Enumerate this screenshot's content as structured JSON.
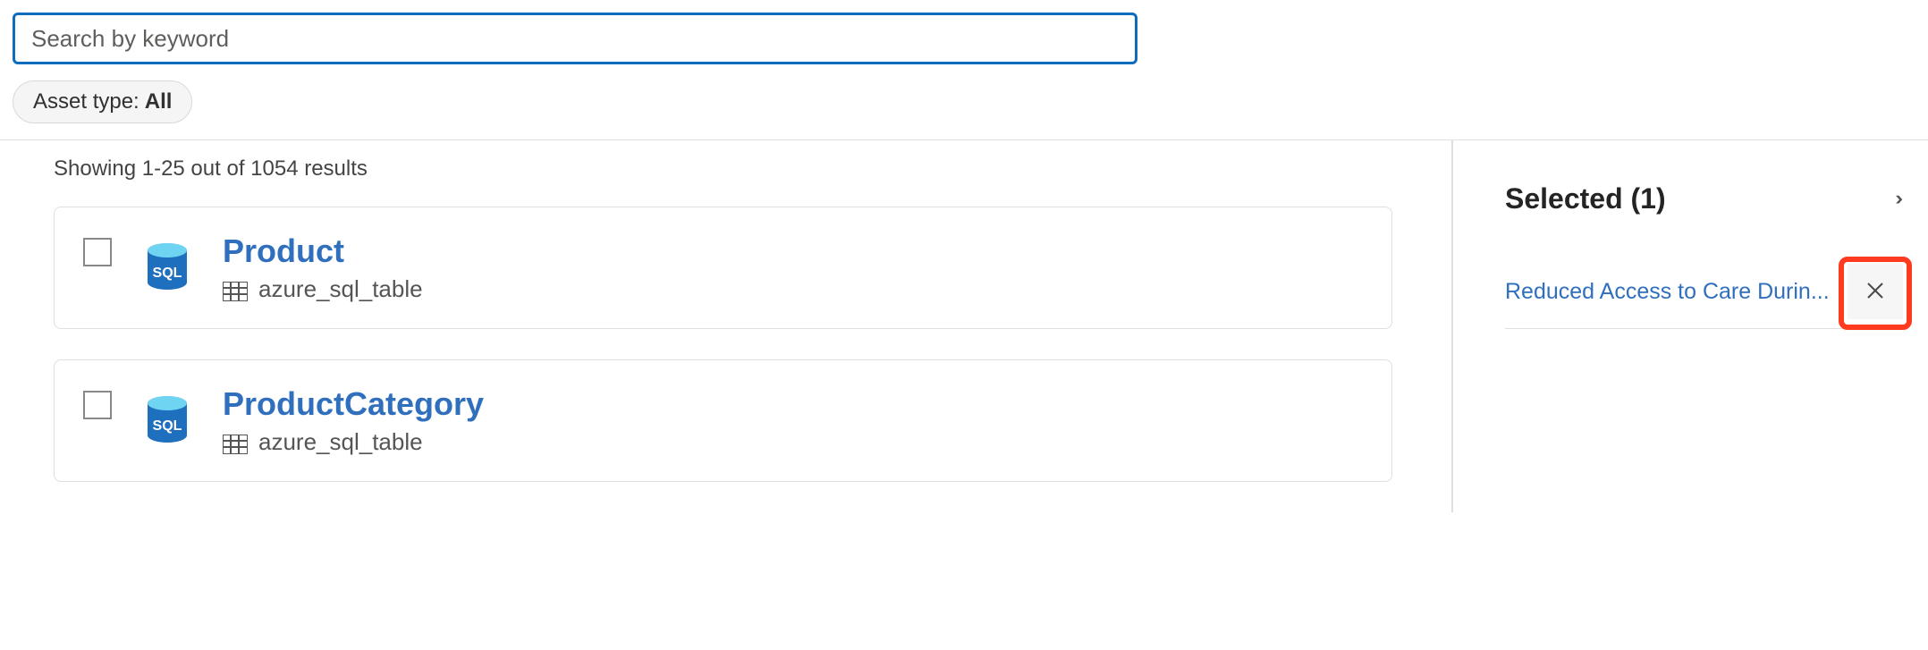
{
  "search": {
    "placeholder": "Search by keyword",
    "value": ""
  },
  "filter": {
    "label": "Asset type:",
    "value": "All"
  },
  "resultsSummary": "Showing 1-25 out of 1054 results",
  "results": [
    {
      "title": "Product",
      "subtype": "azure_sql_table"
    },
    {
      "title": "ProductCategory",
      "subtype": "azure_sql_table"
    }
  ],
  "selected": {
    "title": "Selected (1)",
    "items": [
      {
        "label": "Reduced Access to Care Durin..."
      }
    ]
  }
}
